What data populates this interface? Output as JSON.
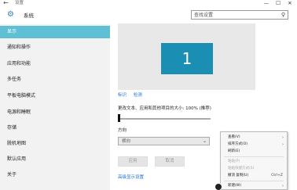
{
  "window": {
    "back_glyph": "←",
    "title": "设置",
    "controls": [
      "—",
      "☐",
      "✕"
    ]
  },
  "header": {
    "gear_glyph": "⚙",
    "title": "系统",
    "search": {
      "placeholder": "查找设置",
      "icon_glyph": "⚲"
    }
  },
  "sidebar": {
    "items": [
      {
        "label": "显示",
        "active": true
      },
      {
        "label": "通知和操作"
      },
      {
        "label": "应用和功能"
      },
      {
        "label": "多任务"
      },
      {
        "label": "平板电脑模式"
      },
      {
        "label": "电源和睡眠"
      },
      {
        "label": "存储"
      },
      {
        "label": "脱机地图"
      },
      {
        "label": "默认应用"
      },
      {
        "label": "关于"
      }
    ]
  },
  "display": {
    "monitor_number": "1",
    "identify_link": "标识",
    "detect_link": "检测",
    "scale_label": "更改文本、应用和其他项目的大小: 100% (推荐)",
    "scale_level": 0.0,
    "orientation_label": "方向",
    "orientation_value": "横向",
    "dropdown_arrow": "⌄",
    "apply_button": "应用",
    "cancel_button": "取消",
    "advanced_link": "高级显示设置"
  },
  "context_menu": {
    "items": [
      {
        "label": "查看(V)",
        "submenu": true,
        "disabled": false
      },
      {
        "label": "排序方式(O)",
        "submenu": true,
        "disabled": false
      },
      {
        "label": "刷新(E)",
        "disabled": false
      },
      {
        "label": "粘贴(P)",
        "disabled": true
      },
      {
        "label": "粘贴快捷方式(S)",
        "disabled": true
      },
      {
        "label": "撤消 复制(U)",
        "shortcut": "Ctrl+Z",
        "disabled": false
      },
      {
        "label": "新建(W)",
        "submenu": true,
        "disabled": false
      }
    ],
    "submenu_arrow": "›"
  }
}
